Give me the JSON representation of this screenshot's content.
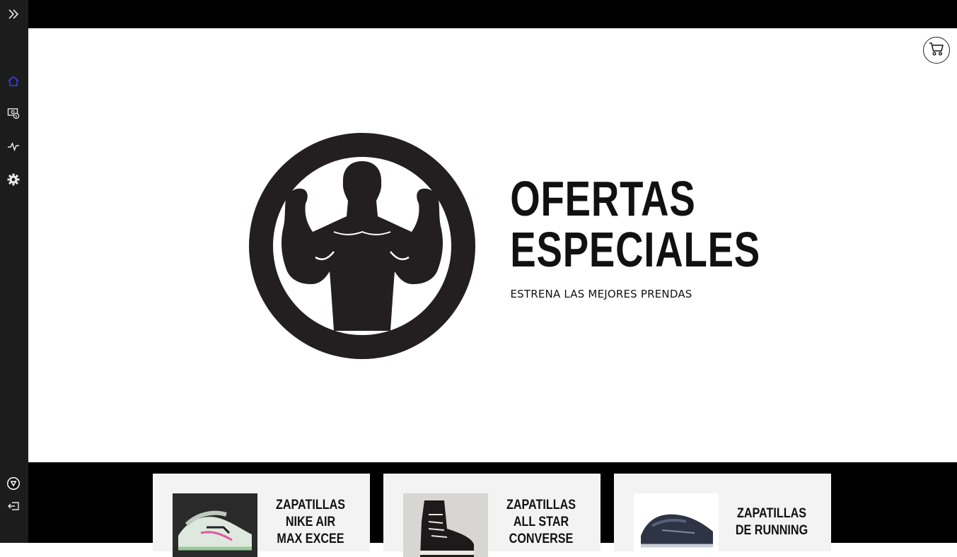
{
  "sidebar": {
    "expand_icon": "double-chevron-right-icon",
    "items": [
      {
        "name": "home",
        "icon": "home-icon",
        "active": true
      },
      {
        "name": "offers",
        "icon": "money-icon"
      },
      {
        "name": "activity",
        "icon": "activity-icon"
      },
      {
        "name": "settings",
        "icon": "gear-icon"
      }
    ],
    "bottom": [
      {
        "name": "brand",
        "icon": "brand-v-icon"
      },
      {
        "name": "logout",
        "icon": "logout-icon"
      }
    ]
  },
  "header": {
    "cart_icon": "cart-icon"
  },
  "hero": {
    "title_line1": "OFERTAS",
    "title_line2": "ESPECIALES",
    "subtitle": "ESTRENA LAS MEJORES PRENDAS"
  },
  "products": [
    {
      "name": "ZAPATILLAS NIKE AIR MAX EXCEE"
    },
    {
      "name": "ZAPATILLAS ALL STAR CONVERSE"
    },
    {
      "name": "ZAPATILLAS DE RUNNING"
    }
  ],
  "colors": {
    "sidebar_bg": "#1c1c1c",
    "topbar_bg": "#000000",
    "active_icon": "#3b3bff",
    "card_bg": "#f3f3f3",
    "logo_dark": "#231f20"
  }
}
